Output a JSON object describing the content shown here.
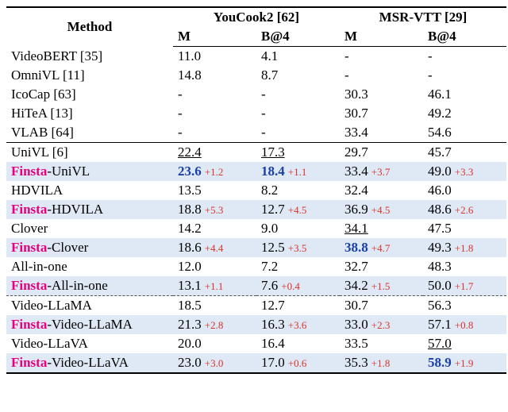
{
  "header": {
    "method": "Method",
    "datasets": [
      {
        "name": "YouCook2 [62]",
        "cols": [
          "M",
          "B@4"
        ]
      },
      {
        "name": "MSR-VTT [29]",
        "cols": [
          "M",
          "B@4"
        ]
      }
    ]
  },
  "rows": [
    {
      "method": "VideoBERT [35]",
      "vals": [
        {
          "v": "11.0"
        },
        {
          "v": "4.1"
        },
        {
          "v": "-"
        },
        {
          "v": "-"
        }
      ]
    },
    {
      "method": "OmniVL [11]",
      "vals": [
        {
          "v": "14.8"
        },
        {
          "v": "8.7"
        },
        {
          "v": "-"
        },
        {
          "v": "-"
        }
      ]
    },
    {
      "method": "IcoCap [63]",
      "vals": [
        {
          "v": "-"
        },
        {
          "v": "-"
        },
        {
          "v": "30.3"
        },
        {
          "v": "46.1"
        }
      ]
    },
    {
      "method": "HiTeA [13]",
      "vals": [
        {
          "v": "-"
        },
        {
          "v": "-"
        },
        {
          "v": "30.7"
        },
        {
          "v": "49.2"
        }
      ]
    },
    {
      "method": "VLAB [64]",
      "sep": true,
      "vals": [
        {
          "v": "-"
        },
        {
          "v": "-"
        },
        {
          "v": "33.4"
        },
        {
          "v": "54.6"
        }
      ]
    },
    {
      "method": "UniVL [6]",
      "vals": [
        {
          "v": "22.4",
          "u": true
        },
        {
          "v": "17.3",
          "u": true
        },
        {
          "v": "29.7"
        },
        {
          "v": "45.7"
        }
      ]
    },
    {
      "method_prefix": "Finsta",
      "method_suffix": "-UniVL",
      "hl": true,
      "vals": [
        {
          "v": "23.6",
          "b": true,
          "d": "+1.2"
        },
        {
          "v": "18.4",
          "b": true,
          "d": "+1.1"
        },
        {
          "v": "33.4",
          "d": "+3.7"
        },
        {
          "v": "49.0",
          "d": "+3.3"
        }
      ]
    },
    {
      "method": "HDVILA",
      "vals": [
        {
          "v": "13.5"
        },
        {
          "v": "8.2"
        },
        {
          "v": "32.4"
        },
        {
          "v": "46.0"
        }
      ]
    },
    {
      "method_prefix": "Finsta",
      "method_suffix": "-HDVILA",
      "hl": true,
      "vals": [
        {
          "v": "18.8",
          "d": "+5.3"
        },
        {
          "v": "12.7",
          "d": "+4.5"
        },
        {
          "v": "36.9",
          "d": "+4.5"
        },
        {
          "v": "48.6",
          "d": "+2.6"
        }
      ]
    },
    {
      "method": "Clover",
      "vals": [
        {
          "v": "14.2"
        },
        {
          "v": "9.0"
        },
        {
          "v": "34.1",
          "u": true
        },
        {
          "v": "47.5"
        }
      ]
    },
    {
      "method_prefix": "Finsta",
      "method_suffix": "-Clover",
      "hl": true,
      "vals": [
        {
          "v": "18.6",
          "d": "+4.4"
        },
        {
          "v": "12.5",
          "d": "+3.5"
        },
        {
          "v": "38.8",
          "b": true,
          "d": "+4.7"
        },
        {
          "v": "49.3",
          "d": "+1.8"
        }
      ]
    },
    {
      "method": "All-in-one",
      "vals": [
        {
          "v": "12.0"
        },
        {
          "v": "7.2"
        },
        {
          "v": "32.7"
        },
        {
          "v": "48.3"
        }
      ]
    },
    {
      "method_prefix": "Finsta",
      "method_suffix": "-All-in-one",
      "hl": true,
      "vals": [
        {
          "v": "13.1",
          "d": "+1.1"
        },
        {
          "v": "7.6",
          "d": "+0.4"
        },
        {
          "v": "34.2",
          "d": "+1.5"
        },
        {
          "v": "50.0",
          "d": "+1.7"
        }
      ]
    },
    {
      "method": "Video-LLaMA",
      "dashed": true,
      "vals": [
        {
          "v": "18.5"
        },
        {
          "v": "12.7"
        },
        {
          "v": "30.7"
        },
        {
          "v": "56.3"
        }
      ]
    },
    {
      "method_prefix": "Finsta",
      "method_suffix": "-Video-LLaMA",
      "hl": true,
      "vals": [
        {
          "v": "21.3",
          "d": "+2.8"
        },
        {
          "v": "16.3",
          "d": "+3.6"
        },
        {
          "v": "33.0",
          "d": "+2.3"
        },
        {
          "v": "57.1",
          "d": "+0.8"
        }
      ]
    },
    {
      "method": "Video-LLaVA",
      "vals": [
        {
          "v": "20.0"
        },
        {
          "v": "16.4"
        },
        {
          "v": "33.5"
        },
        {
          "v": "57.0",
          "u": true
        }
      ]
    },
    {
      "method_prefix": "Finsta",
      "method_suffix": "-Video-LLaVA",
      "hl": true,
      "bottom": true,
      "vals": [
        {
          "v": "23.0",
          "d": "+3.0"
        },
        {
          "v": "17.0",
          "d": "+0.6"
        },
        {
          "v": "35.3",
          "d": "+1.8"
        },
        {
          "v": "58.9",
          "b": true,
          "d": "+1.9"
        }
      ]
    }
  ],
  "chart_data": {
    "type": "table",
    "title": "Results on YouCook2 and MSR-VTT",
    "columns": [
      "Method",
      "YouCook2 M",
      "YouCook2 B@4",
      "MSR-VTT M",
      "MSR-VTT B@4"
    ],
    "rows": [
      [
        "VideoBERT [35]",
        11.0,
        4.1,
        null,
        null
      ],
      [
        "OmniVL [11]",
        14.8,
        8.7,
        null,
        null
      ],
      [
        "IcoCap [63]",
        null,
        null,
        30.3,
        46.1
      ],
      [
        "HiTeA [13]",
        null,
        null,
        30.7,
        49.2
      ],
      [
        "VLAB [64]",
        null,
        null,
        33.4,
        54.6
      ],
      [
        "UniVL [6]",
        22.4,
        17.3,
        29.7,
        45.7
      ],
      [
        "Finsta-UniVL",
        23.6,
        18.4,
        33.4,
        49.0
      ],
      [
        "HDVILA",
        13.5,
        8.2,
        32.4,
        46.0
      ],
      [
        "Finsta-HDVILA",
        18.8,
        12.7,
        36.9,
        48.6
      ],
      [
        "Clover",
        14.2,
        9.0,
        34.1,
        47.5
      ],
      [
        "Finsta-Clover",
        18.6,
        12.5,
        38.8,
        49.3
      ],
      [
        "All-in-one",
        12.0,
        7.2,
        32.7,
        48.3
      ],
      [
        "Finsta-All-in-one",
        13.1,
        7.6,
        34.2,
        50.0
      ],
      [
        "Video-LLaMA",
        18.5,
        12.7,
        30.7,
        56.3
      ],
      [
        "Finsta-Video-LLaMA",
        21.3,
        16.3,
        33.0,
        57.1
      ],
      [
        "Video-LLaVA",
        20.0,
        16.4,
        33.5,
        57.0
      ],
      [
        "Finsta-Video-LLaVA",
        23.0,
        17.0,
        35.3,
        58.9
      ]
    ]
  }
}
